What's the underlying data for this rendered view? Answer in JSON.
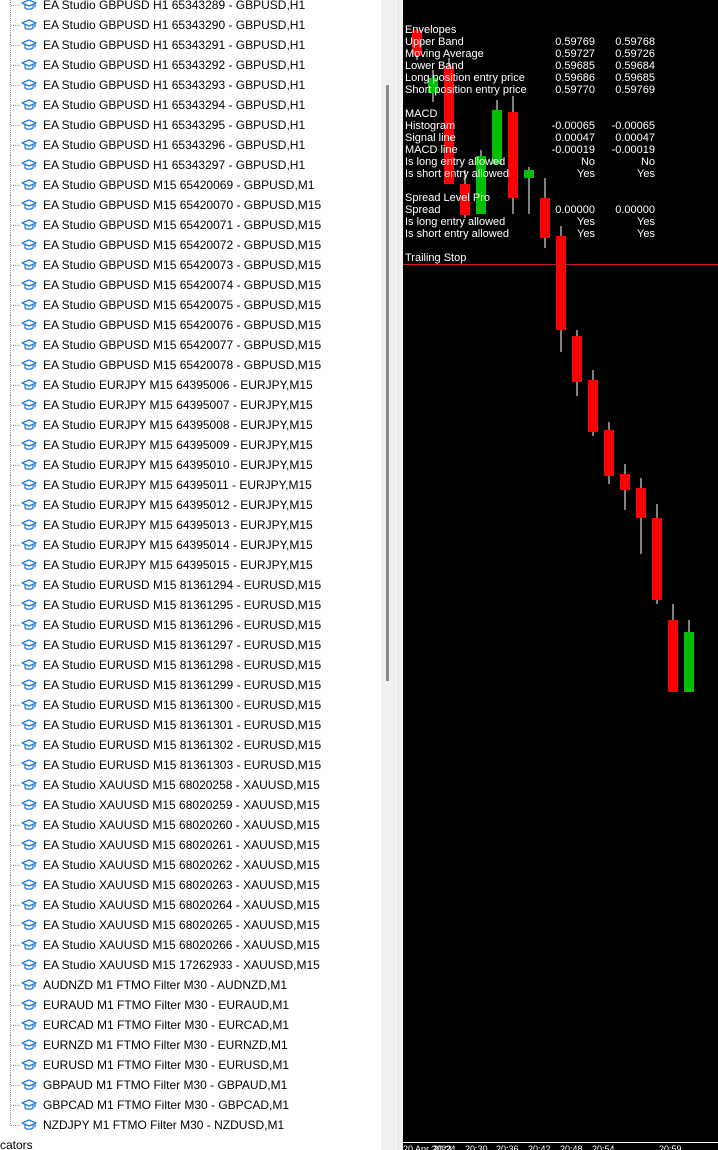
{
  "navigator": {
    "items": [
      "EA Studio GBPUSD H1 65343289 - GBPUSD,H1",
      "EA Studio GBPUSD H1 65343290 - GBPUSD,H1",
      "EA Studio GBPUSD H1 65343291 - GBPUSD,H1",
      "EA Studio GBPUSD H1 65343292 - GBPUSD,H1",
      "EA Studio GBPUSD H1 65343293 - GBPUSD,H1",
      "EA Studio GBPUSD H1 65343294 - GBPUSD,H1",
      "EA Studio GBPUSD H1 65343295 - GBPUSD,H1",
      "EA Studio GBPUSD H1 65343296 - GBPUSD,H1",
      "EA Studio GBPUSD H1 65343297 - GBPUSD,H1",
      "EA Studio GBPUSD M15 65420069 - GBPUSD,M1",
      "EA Studio GBPUSD M15 65420070 - GBPUSD,M15",
      "EA Studio GBPUSD M15 65420071 - GBPUSD,M15",
      "EA Studio GBPUSD M15 65420072 - GBPUSD,M15",
      "EA Studio GBPUSD M15 65420073 - GBPUSD,M15",
      "EA Studio GBPUSD M15 65420074 - GBPUSD,M15",
      "EA Studio GBPUSD M15 65420075 - GBPUSD,M15",
      "EA Studio GBPUSD M15 65420076 - GBPUSD,M15",
      "EA Studio GBPUSD M15 65420077 - GBPUSD,M15",
      "EA Studio GBPUSD M15 65420078 - GBPUSD,M15",
      "EA Studio EURJPY M15 64395006 - EURJPY,M15",
      "EA Studio EURJPY M15 64395007 - EURJPY,M15",
      "EA Studio EURJPY M15 64395008 - EURJPY,M15",
      "EA Studio EURJPY M15 64395009 - EURJPY,M15",
      "EA Studio EURJPY M15 64395010 - EURJPY,M15",
      "EA Studio EURJPY M15 64395011 - EURJPY,M15",
      "EA Studio EURJPY M15 64395012 - EURJPY,M15",
      "EA Studio EURJPY M15 64395013 - EURJPY,M15",
      "EA Studio EURJPY M15 64395014 - EURJPY,M15",
      "EA Studio EURJPY M15 64395015 - EURJPY,M15",
      "EA Studio EURUSD M15 81361294 - EURUSD,M15",
      "EA Studio EURUSD M15 81361295 - EURUSD,M15",
      "EA Studio EURUSD M15 81361296 - EURUSD,M15",
      "EA Studio EURUSD M15 81361297 - EURUSD,M15",
      "EA Studio EURUSD M15 81361298 - EURUSD,M15",
      "EA Studio EURUSD M15 81361299 - EURUSD,M15",
      "EA Studio EURUSD M15 81361300 - EURUSD,M15",
      "EA Studio EURUSD M15 81361301 - EURUSD,M15",
      "EA Studio EURUSD M15 81361302 - EURUSD,M15",
      "EA Studio EURUSD M15 81361303 - EURUSD,M15",
      "EA Studio XAUUSD M15 68020258 - XAUUSD,M15",
      "EA Studio XAUUSD M15 68020259 - XAUUSD,M15",
      "EA Studio XAUUSD M15 68020260 - XAUUSD,M15",
      "EA Studio XAUUSD M15 68020261 - XAUUSD,M15",
      "EA Studio XAUUSD M15 68020262 - XAUUSD,M15",
      "EA Studio XAUUSD M15 68020263 - XAUUSD,M15",
      "EA Studio XAUUSD M15 68020264 - XAUUSD,M15",
      "EA Studio XAUUSD M15 68020265 - XAUUSD,M15",
      "EA Studio XAUUSD M15 68020266 - XAUUSD,M15",
      "EA Studio XAUUSD M15 17262933 - XAUUSD,M15",
      "AUDNZD  M1 FTMO Filter M30 - AUDNZD,M1",
      "EURAUD  M1 FTMO Filter M30 - EURAUD,M1",
      "EURCAD  M1 FTMO Filter M30 - EURCAD,M1",
      "EURNZD  M1 FTMO Filter M30 - EURNZD,M1",
      "EURUSD M1 FTMO Filter M30 - EURUSD,M1",
      "GBPAUD  M1 FTMO Filter M30 - GBPAUD,M1",
      "GBPCAD  M1 FTMO Filter M30 - GBPCAD,M1",
      "NZDJPY  M1 FTMO Filter M30 - NZDUSD,M1"
    ],
    "tail_text": "cators",
    "item_icon": "graduation-cap-icon",
    "icon_color": "#2a7fd4"
  },
  "indicators": [
    {
      "name": "Envelopes",
      "v1": "",
      "v2": ""
    },
    {
      "name": "Upper Band",
      "v1": "0.59769",
      "v2": "0.59768"
    },
    {
      "name": "Moving Average",
      "v1": "0.59727",
      "v2": "0.59726"
    },
    {
      "name": "Lower Band",
      "v1": "0.59685",
      "v2": "0.59684"
    },
    {
      "name": "Long position entry price",
      "v1": "0.59686",
      "v2": "0.59685"
    },
    {
      "name": "Short position entry price",
      "v1": "0.59770",
      "v2": "0.59769"
    },
    {
      "name": "",
      "v1": "",
      "v2": ""
    },
    {
      "name": "MACD",
      "v1": "",
      "v2": ""
    },
    {
      "name": "Histogram",
      "v1": "-0.00065",
      "v2": "-0.00065"
    },
    {
      "name": "Signal line",
      "v1": "0.00047",
      "v2": "0.00047"
    },
    {
      "name": "MACD line",
      "v1": "-0.00019",
      "v2": "-0.00019"
    },
    {
      "name": "Is long entry allowed",
      "v1": "No",
      "v2": "No"
    },
    {
      "name": "Is short entry allowed",
      "v1": "Yes",
      "v2": "Yes"
    },
    {
      "name": "",
      "v1": "",
      "v2": ""
    },
    {
      "name": "Spread Level Pro",
      "v1": "",
      "v2": ""
    },
    {
      "name": "Spread",
      "v1": "0.00000",
      "v2": "0.00000"
    },
    {
      "name": "Is long entry allowed",
      "v1": "Yes",
      "v2": "Yes"
    },
    {
      "name": "Is short entry allowed",
      "v1": "Yes",
      "v2": "Yes"
    },
    {
      "name": "",
      "v1": "",
      "v2": ""
    },
    {
      "name": "Trailing Stop",
      "v1": "",
      "v2": ""
    }
  ],
  "time_axis": [
    "20 Apr 2023",
    "20:24",
    "20:30",
    "20:36",
    "20:42",
    "20:48",
    "20:54",
    "20:59"
  ],
  "colors": {
    "bull": "#00c000",
    "bear": "#ff0000",
    "background": "#000000",
    "stop_line": "#d01818"
  },
  "chart_data": {
    "type": "candlestick",
    "candles": [
      {
        "dir": "bear"
      },
      {
        "dir": "bull"
      },
      {
        "dir": "bear"
      },
      {
        "dir": "bear"
      },
      {
        "dir": "bull"
      },
      {
        "dir": "bull"
      },
      {
        "dir": "bear"
      },
      {
        "dir": "bull"
      },
      {
        "dir": "bear"
      },
      {
        "dir": "bear"
      },
      {
        "dir": "bear"
      },
      {
        "dir": "bear"
      },
      {
        "dir": "bear"
      },
      {
        "dir": "bear"
      },
      {
        "dir": "bear"
      },
      {
        "dir": "bear"
      },
      {
        "dir": "bear"
      },
      {
        "dir": "bull"
      }
    ]
  }
}
